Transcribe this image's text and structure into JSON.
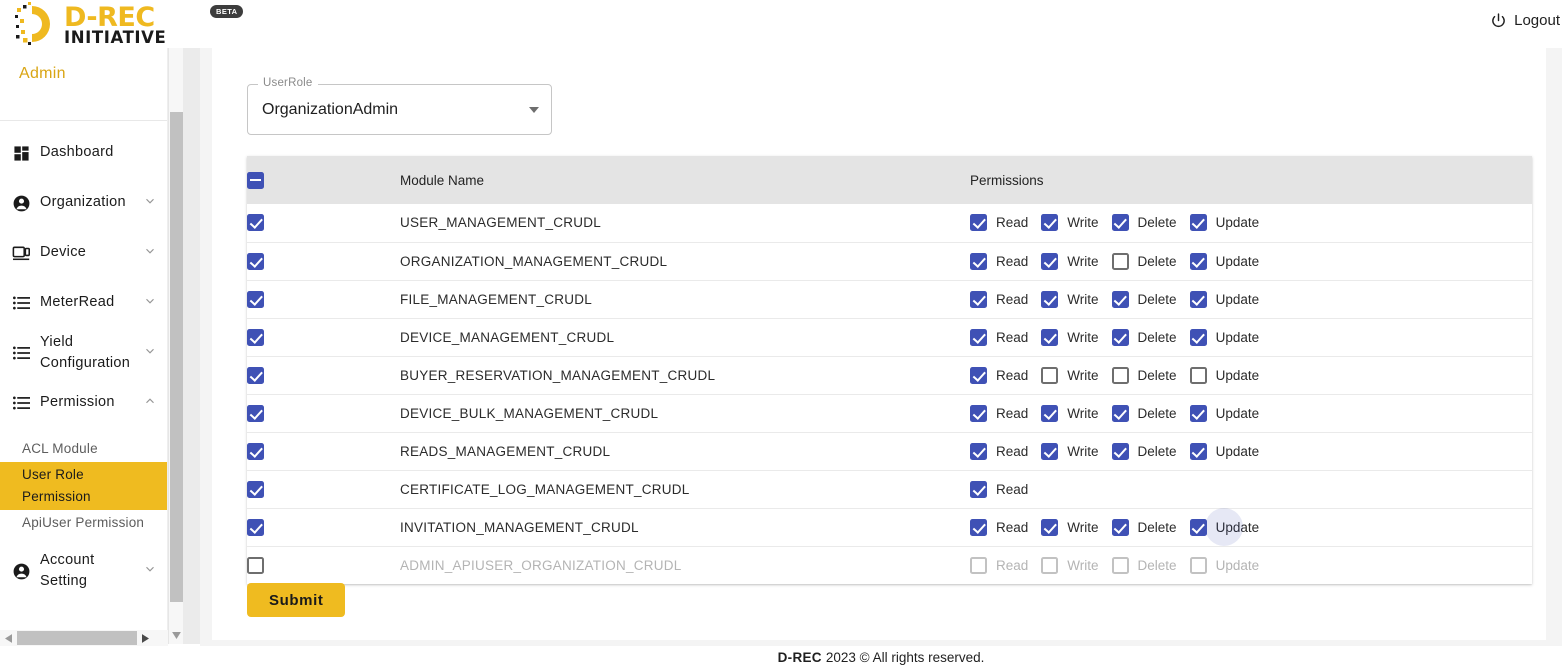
{
  "header": {
    "logo_drec": "D-REC",
    "logo_initiative": "INITIATIVE",
    "beta_badge": "BETA",
    "logout_label": "Logout",
    "power_icon": "power-icon"
  },
  "sidebar": {
    "section_label": "Admin",
    "items": [
      {
        "label": "Dashboard",
        "icon": "dashboard-icon",
        "chevron": ""
      },
      {
        "label": "Organization",
        "icon": "account-circle-icon",
        "chevron": "chevron-down-icon"
      },
      {
        "label": "Device",
        "icon": "device-icon",
        "chevron": "chevron-down-icon"
      },
      {
        "label": "MeterRead",
        "icon": "list-icon",
        "chevron": "chevron-down-icon"
      },
      {
        "label": "Yield Configuration",
        "icon": "list-icon",
        "chevron": "chevron-down-icon"
      },
      {
        "label": "Permission",
        "icon": "list-icon",
        "chevron": "chevron-up-icon"
      }
    ],
    "sub_items": [
      {
        "label": "ACL Module",
        "active": false
      },
      {
        "label": "User Role Permission",
        "active": true
      },
      {
        "label": "ApiUser Permission",
        "active": false
      }
    ],
    "account_item": {
      "label": "Account Setting",
      "icon": "account-circle-icon",
      "chevron": "chevron-down-icon"
    }
  },
  "form": {
    "userrole_legend": "UserRole",
    "userrole_value": "OrganizationAdmin",
    "dropdown_icon": "chevron-down-icon"
  },
  "table": {
    "headers": {
      "select_all": "indeterminate",
      "module_name": "Module Name",
      "permissions": "Permissions"
    },
    "permission_labels": [
      "Read",
      "Write",
      "Delete",
      "Update"
    ],
    "rows": [
      {
        "selected": true,
        "module": "USER_MANAGEMENT_CRUDL",
        "disabled": false,
        "perms": [
          true,
          true,
          true,
          true
        ],
        "focused": null
      },
      {
        "selected": true,
        "module": "ORGANIZATION_MANAGEMENT_CRUDL",
        "disabled": false,
        "perms": [
          true,
          true,
          false,
          true
        ],
        "focused": null
      },
      {
        "selected": true,
        "module": "FILE_MANAGEMENT_CRUDL",
        "disabled": false,
        "perms": [
          true,
          true,
          true,
          true
        ],
        "focused": null
      },
      {
        "selected": true,
        "module": "DEVICE_MANAGEMENT_CRUDL",
        "disabled": false,
        "perms": [
          true,
          true,
          true,
          true
        ],
        "focused": null
      },
      {
        "selected": true,
        "module": "BUYER_RESERVATION_MANAGEMENT_CRUDL",
        "disabled": false,
        "perms": [
          true,
          false,
          false,
          false
        ],
        "focused": null
      },
      {
        "selected": true,
        "module": "DEVICE_BULK_MANAGEMENT_CRUDL",
        "disabled": false,
        "perms": [
          true,
          true,
          true,
          true
        ],
        "focused": null
      },
      {
        "selected": true,
        "module": "READS_MANAGEMENT_CRUDL",
        "disabled": false,
        "perms": [
          true,
          true,
          true,
          true
        ],
        "focused": null
      },
      {
        "selected": true,
        "module": "CERTIFICATE_LOG_MANAGEMENT_CRUDL",
        "disabled": false,
        "perms": [
          true
        ],
        "focused": null
      },
      {
        "selected": true,
        "module": "INVITATION_MANAGEMENT_CRUDL",
        "disabled": false,
        "perms": [
          true,
          true,
          true,
          true
        ],
        "focused": 3
      },
      {
        "selected": false,
        "module": "ADMIN_APIUSER_ORGANIZATION_CRUDL",
        "disabled": true,
        "perms": [
          false,
          false,
          false,
          false
        ],
        "focused": null
      }
    ]
  },
  "actions": {
    "submit_label": "Submit"
  },
  "footer": {
    "brand": "D-REC",
    "text": "2023 © All rights reserved."
  },
  "colors": {
    "brand_yellow": "#EFBB20",
    "checkbox_blue": "#3F51B5",
    "card_accent": "#5C6BC0",
    "admin_text": "#D9A514"
  }
}
